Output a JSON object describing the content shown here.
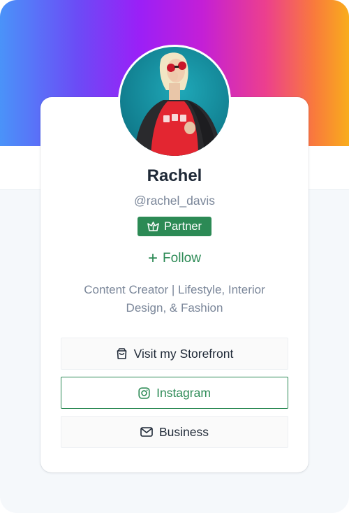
{
  "profile": {
    "name": "Rachel",
    "handle": "@rachel_davis",
    "badge_label": "Partner",
    "follow_label": "Follow",
    "bio_line1": "Content Creator | Lifestyle, Interior",
    "bio_line2": "Design, & Fashion"
  },
  "links": [
    {
      "label": "Visit my Storefront",
      "icon": "shopping-bag-icon"
    },
    {
      "label": "Instagram",
      "icon": "instagram-icon"
    },
    {
      "label": "Business",
      "icon": "mail-icon"
    }
  ],
  "colors": {
    "accent": "#2c8a55",
    "text": "#1f2937",
    "muted": "#7a8699",
    "gradient": [
      "#4a93f9",
      "#9b1ff7",
      "#ec3f8e",
      "#f9ad1c"
    ]
  }
}
